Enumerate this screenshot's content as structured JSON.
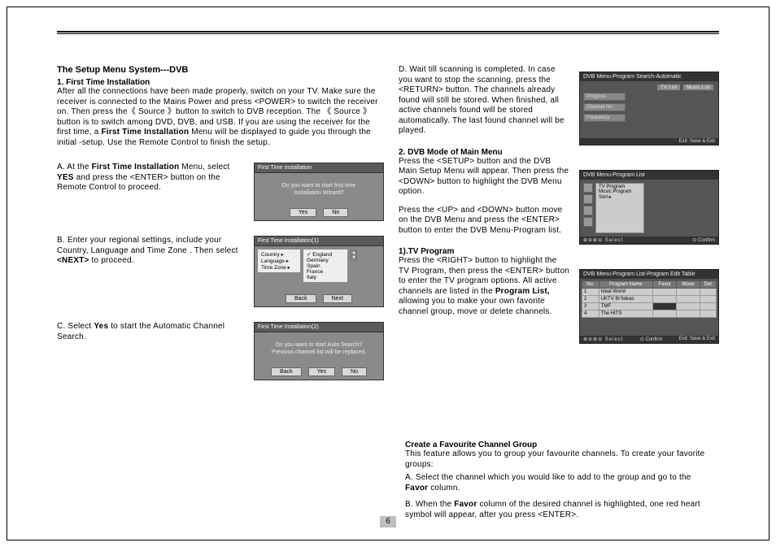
{
  "page_number": "6",
  "title": "The Setup Menu System---DVB",
  "section1": {
    "heading": "1. First Time Installation",
    "intro": "After all the connections have been made properly, switch on your TV. Make sure the receiver is connected to the Mains Power and press <POWER> to switch the receiver on. Then press the《 Source 》button to switch to DVB reception. The 《 Source 》button is to switch among DVD, DVB, and USB. If you are using the receiver for the first time, a",
    "intro_bold": "First Time Installation",
    "intro_tail": " Menu will be displayed to guide you through the  initial -setup. Use the Remote Control to finish the setup.",
    "stepA_pre": "A. At the ",
    "stepA_bold": "First Time Installation",
    "stepA_mid": " Menu, select ",
    "stepA_bold2": "YES",
    "stepA_post": " and press the <ENTER> button on the Remote Control to proceed.",
    "stepB_pre": "B. Enter your regional settings, include your Country,  Language and Time Zone . Then select ",
    "stepB_bold": "<NEXT>",
    "stepB_post": " to proceed.",
    "stepC_pre": "C. Select ",
    "stepC_bold": "Yes",
    "stepC_post": " to start the Automatic Channel Search."
  },
  "dlg1": {
    "title": "First Time Installation",
    "line1": "Do you want to start first time",
    "line2": "Installation Wizard?",
    "yes": "Yes",
    "no": "No"
  },
  "dlg2": {
    "title": "First Time Installation(1)",
    "left": {
      "country": "Country  ▸",
      "language": "Language ▸",
      "tz": "Time Zone ▸"
    },
    "right": {
      "r1": "England",
      "r2": "Germany",
      "r3": "Spain",
      "r4": "France",
      "r5": "Italy"
    },
    "back": "Back",
    "next": "Next"
  },
  "dlg3": {
    "title": "First Time Installation(2)",
    "line1": "Do you want to start Auto Search?",
    "line2": "Previous channel list will be replaced.",
    "back": "Back",
    "yes": "Yes",
    "no": "No"
  },
  "right": {
    "stepD": "D. Wait till scanning is completed. In case you want to stop the scanning, press the <RETURN> button. The channels already found will still be stored. When finished, all active channels found will be stored automatically. The last found channel will be played.",
    "sec2_head": "2. DVB Mode of Main Menu",
    "sec2_p1": "Press the <SETUP> button and the DVB Main Setup Menu will appear. Then press the <DOWN> button to highlight the DVB Menu option.",
    "sec2_p2": "Press the <UP> and <DOWN> button move on the DVB Menu and press the <ENTER> button to enter the DVB Menu-Program list.",
    "tv_head": "1).TV Program",
    "tv_p_pre": "Press the <RIGHT> button to highlight the TV Program, then press the <ENTER> button to enter the TV program options. All active channels are listed in the ",
    "tv_p_bold": "Program List,",
    "tv_p_post": " allowing you to make your own favorite channel group, move or delete channels.",
    "fav_head": "Create a Favourite Channel Group",
    "fav_p": "This feature allows you to group your favourite channels. To create your favorite groups:",
    "fav_a_pre": "A.  Select the channel which you would like to add to the group and go to the ",
    "fav_a_bold": "Favor",
    "fav_a_post": "  column.",
    "fav_b_pre": "B.  When the ",
    "fav_b_bold": "Favor",
    "fav_b_post": " column of the desired channel is highlighted, one red heart symbol will appear, after you press <ENTER>."
  },
  "osd1": {
    "title": "DVB Menu-Program Search-Automatic",
    "tab1": "TV List",
    "tab2": "Music List",
    "f1": "Progress",
    "f2": "Channel No",
    "f3": "Frequency",
    "foot_r": "Exit: Save & Exit"
  },
  "osd2": {
    "title": "DVB Menu-Program List",
    "m1": "TV Program",
    "m2": "Music Program",
    "m3": "Sort               ▸",
    "foot_l": "⊕⊖⊕⊖   Select",
    "foot_r": "⊙  Confirm"
  },
  "osd3": {
    "title": "DVB Menu-Program List-Program Edit Table",
    "h_no": "No.",
    "h_name": "Program Name",
    "h_fav": "Favor",
    "h_move": "Move",
    "h_del": "Del",
    "rows": [
      {
        "no": "1",
        "name": "Ideal World"
      },
      {
        "no": "2",
        "name": "UKTV Br'tideas"
      },
      {
        "no": "3",
        "name": "TMF"
      },
      {
        "no": "4",
        "name": "The HITS"
      }
    ],
    "foot_l": "⊕⊖⊕⊖   Select",
    "foot_m": "⊙  Confirm",
    "foot_r": "Exit: Save & Exit"
  }
}
